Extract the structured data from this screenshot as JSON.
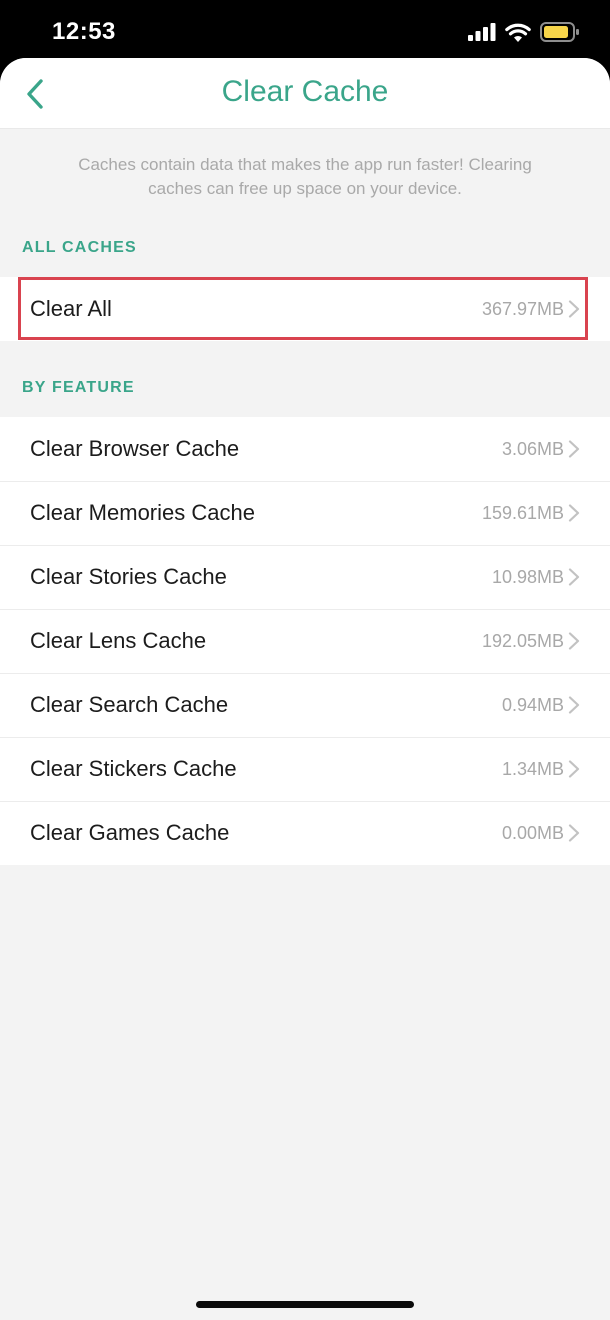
{
  "status_bar": {
    "time": "12:53",
    "icons": [
      "cellular-signal-icon",
      "wifi-icon",
      "battery-icon"
    ]
  },
  "nav": {
    "title": "Clear Cache",
    "back_icon": "chevron-left-icon"
  },
  "description": "Caches contain data that makes the app run faster! Clearing caches can free up space on your device.",
  "all_caches": {
    "header": "ALL CACHES",
    "items": [
      {
        "label": "Clear All",
        "value": "367.97MB",
        "highlighted": true
      }
    ]
  },
  "by_feature": {
    "header": "BY FEATURE",
    "items": [
      {
        "label": "Clear Browser Cache",
        "value": "3.06MB"
      },
      {
        "label": "Clear Memories Cache",
        "value": "159.61MB"
      },
      {
        "label": "Clear Stories Cache",
        "value": "10.98MB"
      },
      {
        "label": "Clear Lens Cache",
        "value": "192.05MB"
      },
      {
        "label": "Clear Search Cache",
        "value": "0.94MB"
      },
      {
        "label": "Clear Stickers Cache",
        "value": "1.34MB"
      },
      {
        "label": "Clear Games Cache",
        "value": "0.00MB"
      }
    ]
  },
  "colors": {
    "accent": "#3aa58a",
    "highlight_border": "#d9434f",
    "battery_fill": "#f7d54a"
  }
}
